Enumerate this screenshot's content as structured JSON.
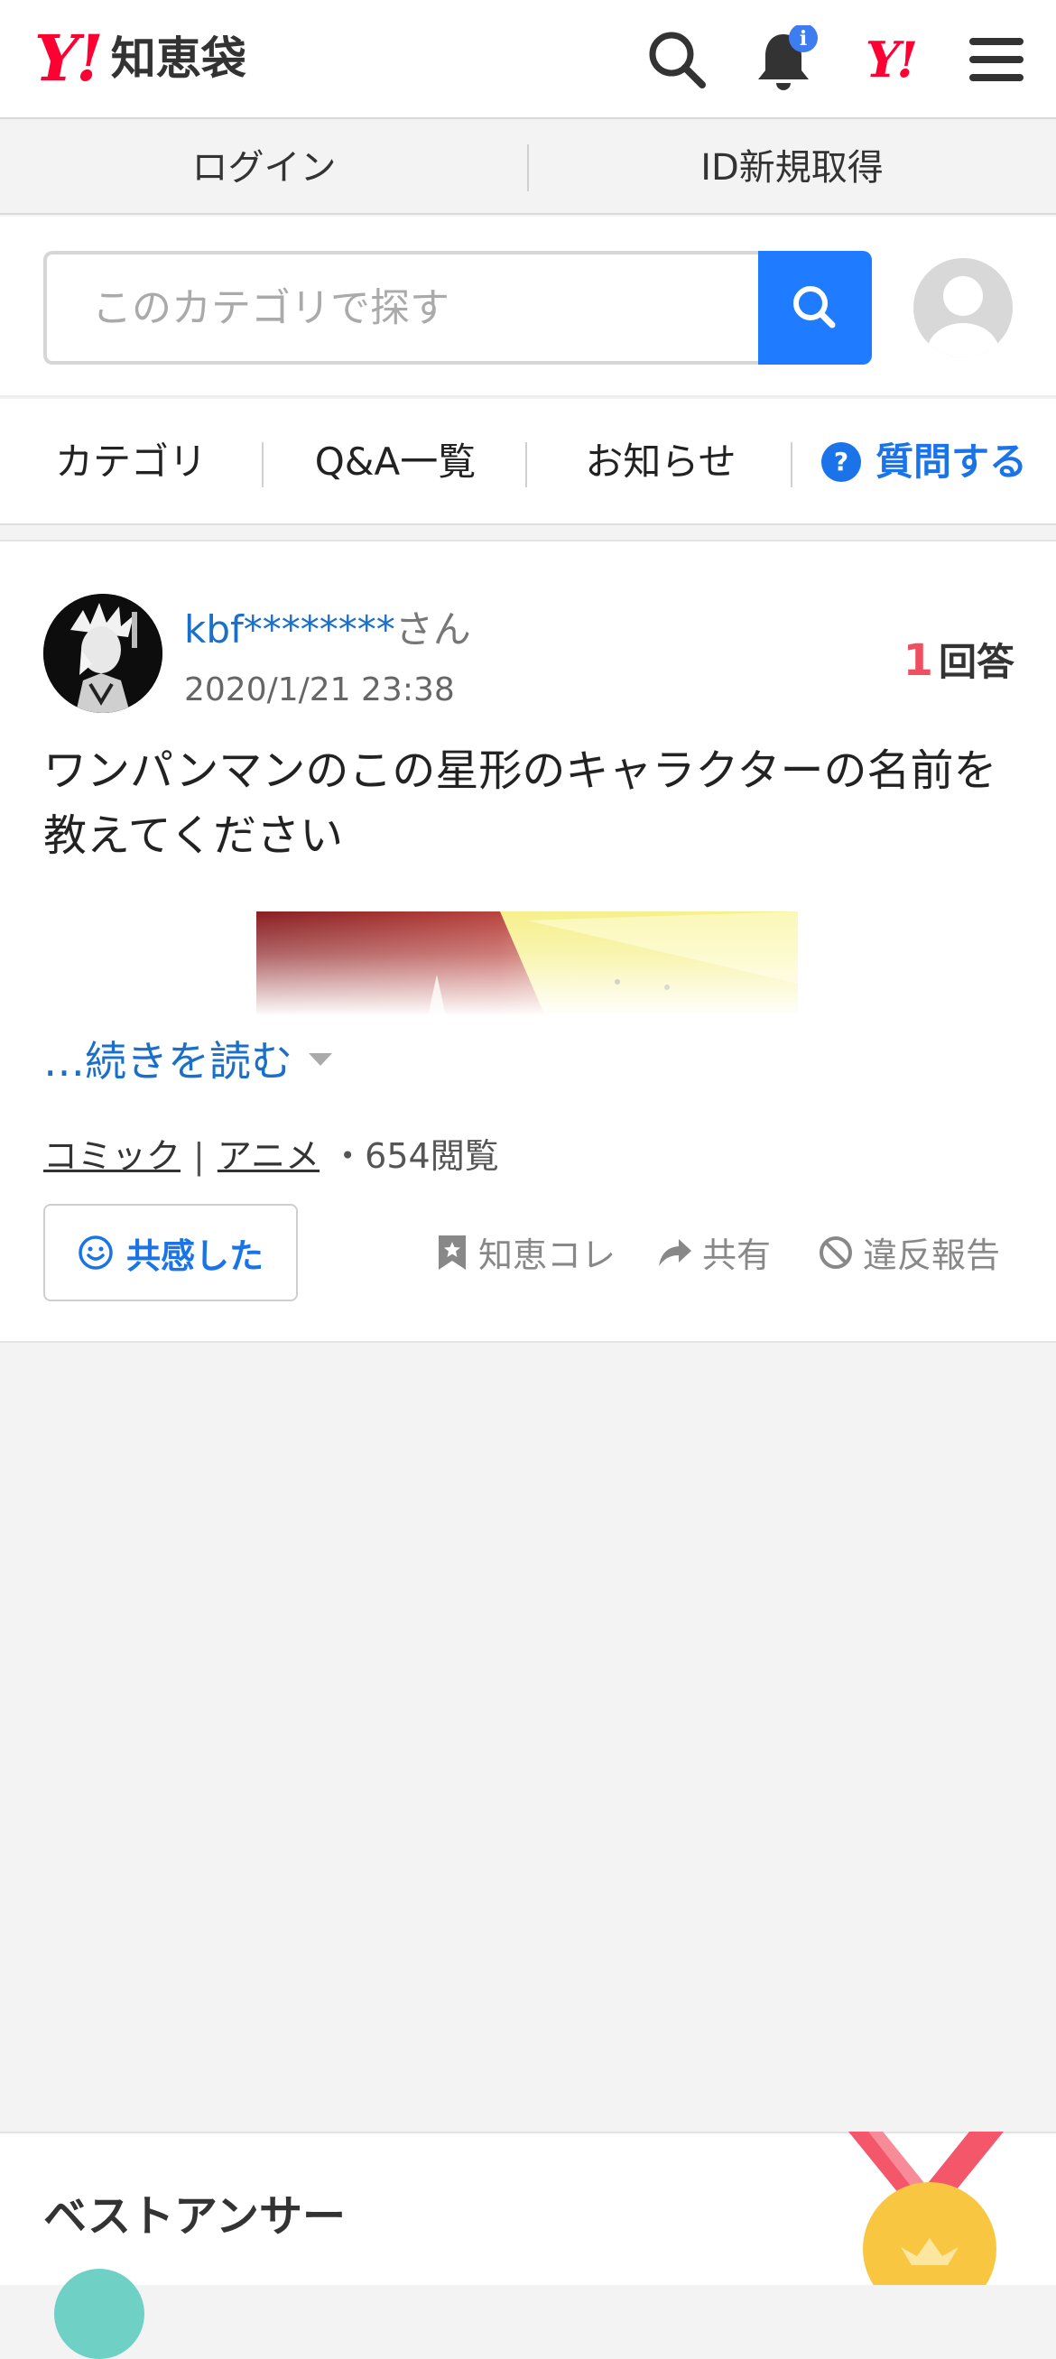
{
  "header": {
    "logo_mark": "Y!",
    "logo_name": "知恵袋",
    "notification_badge": "i",
    "yahoo_badge": "Y!"
  },
  "loginbar": {
    "login": "ログイン",
    "register": "ID新規取得"
  },
  "search": {
    "placeholder": "このカテゴリで探す"
  },
  "nav": {
    "category": "カテゴリ",
    "qa_list": "Q&A一覧",
    "notice": "お知らせ",
    "ask": "質問する"
  },
  "question": {
    "user_name": "kbf********",
    "user_suffix": "さん",
    "date": "2020/1/21 23:38",
    "answer_count": "1",
    "answer_label": "回答",
    "body": "ワンパンマンのこの星形のキャラクターの名前を教えてください",
    "read_more": "…続きを読む",
    "tags": [
      "コミック",
      "アニメ"
    ],
    "views": "・654閲覧",
    "empathy_label": "共感した",
    "actions": {
      "collect": "知恵コレ",
      "share": "共有",
      "report": "違反報告"
    }
  },
  "best_answer": {
    "title": "ベストアンサー"
  },
  "colors": {
    "accent_blue": "#1f7bff",
    "link_blue": "#1a6fc9",
    "brand_red": "#ff0033",
    "count_red": "#ef4f60"
  }
}
